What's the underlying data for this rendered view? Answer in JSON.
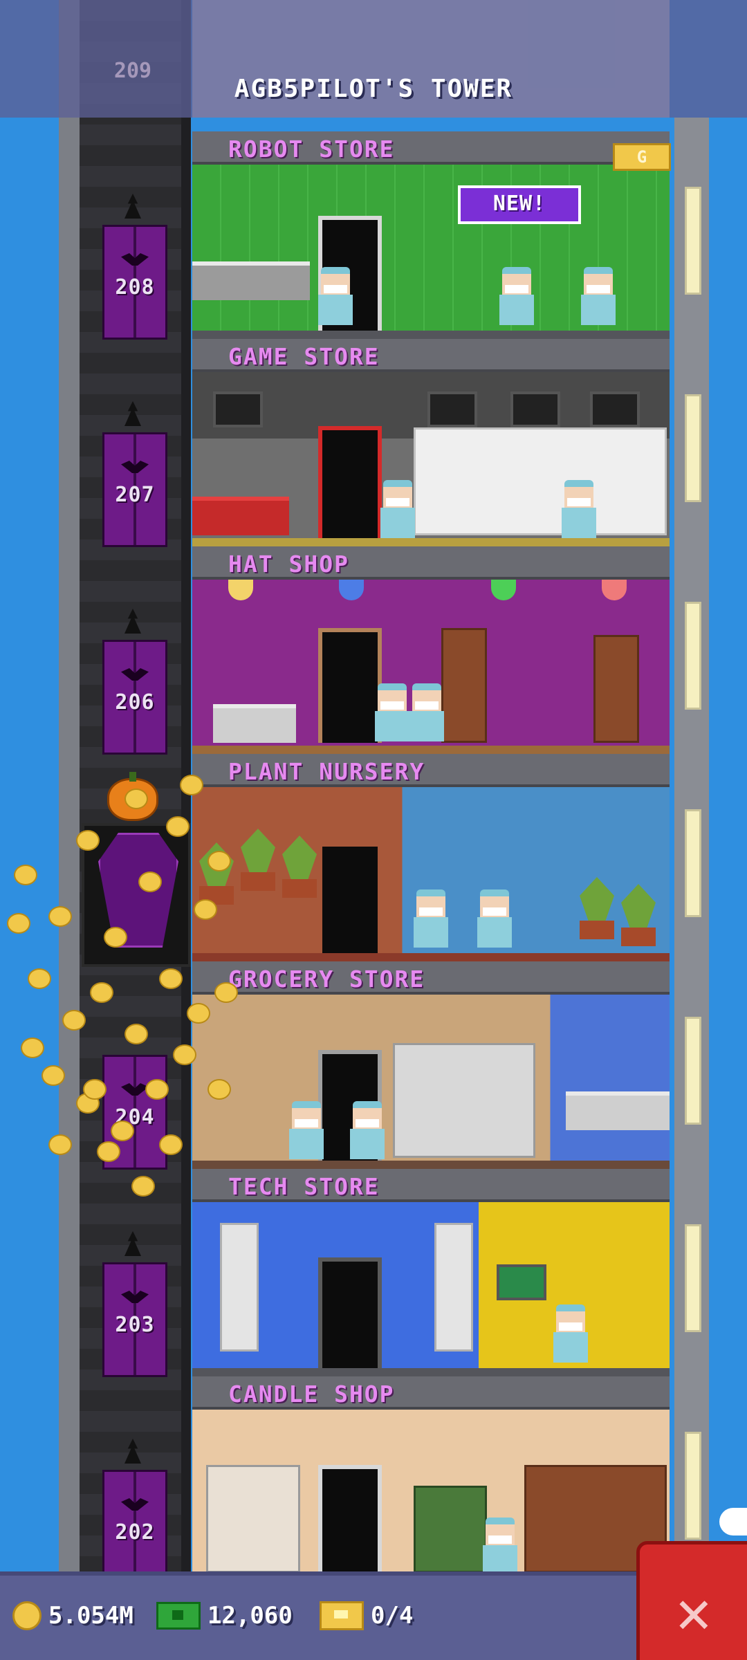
{
  "title": "AGB5PILOT'S TOWER",
  "top_floor_number": "209",
  "new_badge": "NEW!",
  "g_badge": "G",
  "floors": [
    {
      "name": "ROBOT STORE",
      "number": "208"
    },
    {
      "name": "GAME STORE",
      "number": "207"
    },
    {
      "name": "HAT SHOP",
      "number": "206"
    },
    {
      "name": "PLANT NURSERY",
      "number": ""
    },
    {
      "name": "GROCERY STORE",
      "number": "204"
    },
    {
      "name": "TECH STORE",
      "number": "203"
    },
    {
      "name": "CANDLE SHOP",
      "number": "202"
    }
  ],
  "status": {
    "coins": "5.054M",
    "bux": "12,060",
    "tickets": "0/4"
  },
  "icons": {
    "coins": "coin-icon",
    "bux": "bux-icon",
    "tickets": "ticket-icon",
    "close": "close-icon"
  },
  "colors": {
    "floor_label": "#e68af0",
    "elevator_door": "#6e1b88",
    "status_bar": "#5b5f93",
    "close_button": "#d42a2a",
    "sky": "#2f8fe0"
  }
}
